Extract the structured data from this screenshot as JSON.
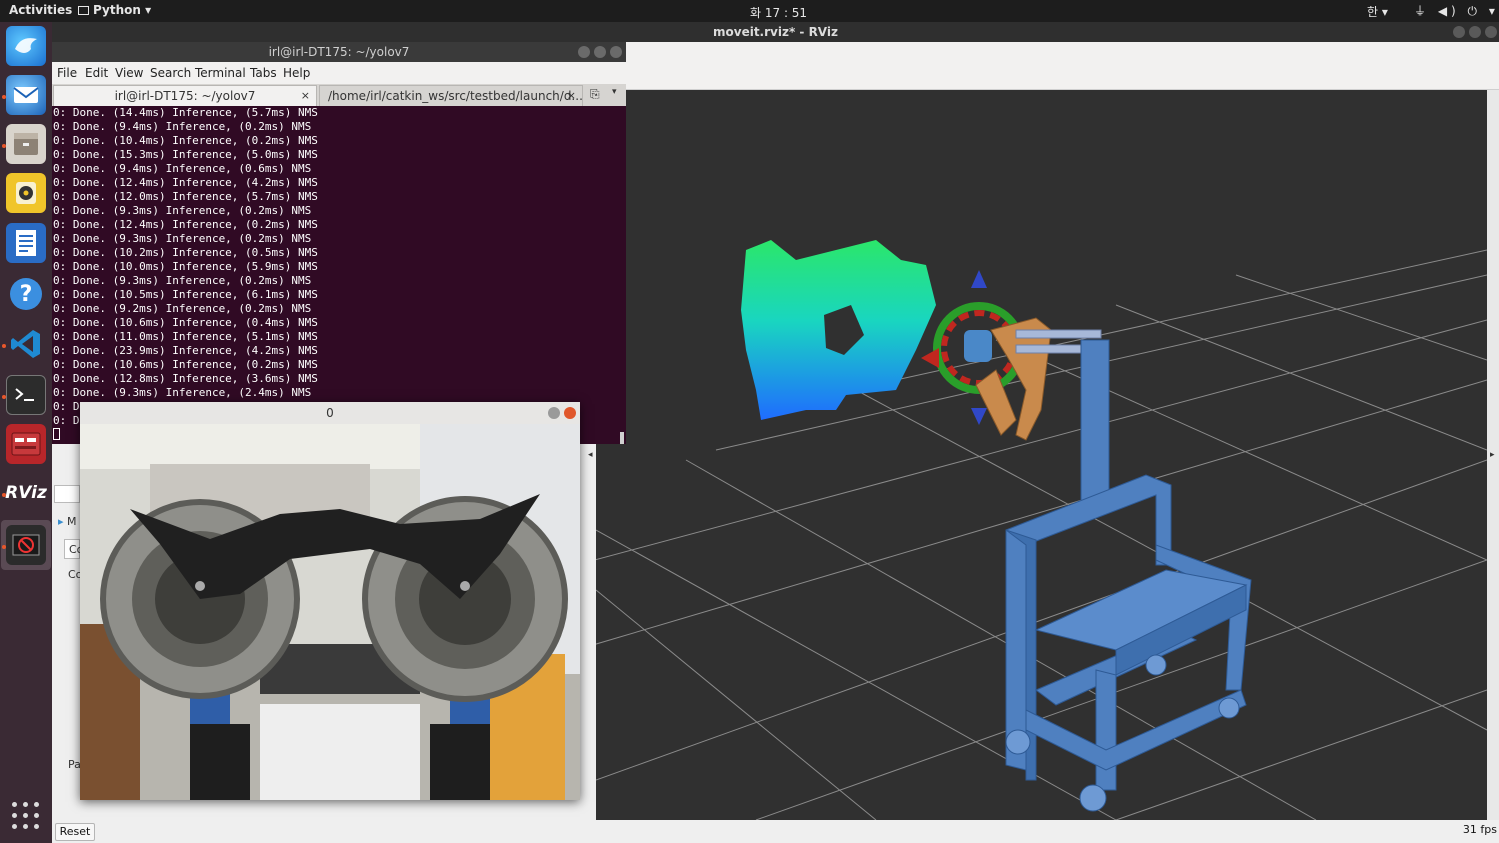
{
  "topbar": {
    "activities": "Activities",
    "app_menu": "Python ▾",
    "clock": "화 17 : 51",
    "ime": "한 ▾",
    "tray": "⏚ ◀) ⏻ ▾"
  },
  "rviz": {
    "title": "moveit.rviz* - RViz",
    "reset_label": "Reset",
    "fps": "31 fps",
    "left_fragments": [
      "M",
      "Co",
      "Co",
      "Pa"
    ]
  },
  "terminal": {
    "title": "irl@irl-DT175: ~/yolov7",
    "menu": [
      "File",
      "Edit",
      "View",
      "Search",
      "Terminal",
      "Tabs",
      "Help"
    ],
    "tabs": [
      {
        "label": "irl@irl-DT175: ~/yolov7",
        "close": "×"
      },
      {
        "label": "/home/irl/catkin_ws/src/testbed/launch/d...",
        "close": "×"
      }
    ],
    "lines": [
      "0: Done. (14.4ms) Inference, (5.7ms) NMS",
      "0: Done. (9.4ms) Inference, (0.2ms) NMS",
      "0: Done. (10.4ms) Inference, (0.2ms) NMS",
      "0: Done. (15.3ms) Inference, (5.0ms) NMS",
      "0: Done. (9.4ms) Inference, (0.6ms) NMS",
      "0: Done. (12.4ms) Inference, (4.2ms) NMS",
      "0: Done. (12.0ms) Inference, (5.7ms) NMS",
      "0: Done. (9.3ms) Inference, (0.2ms) NMS",
      "0: Done. (12.4ms) Inference, (0.2ms) NMS",
      "0: Done. (9.3ms) Inference, (0.2ms) NMS",
      "0: Done. (10.2ms) Inference, (0.5ms) NMS",
      "0: Done. (10.0ms) Inference, (5.9ms) NMS",
      "0: Done. (9.3ms) Inference, (0.2ms) NMS",
      "0: Done. (10.5ms) Inference, (6.1ms) NMS",
      "0: Done. (9.2ms) Inference, (0.2ms) NMS",
      "0: Done. (10.6ms) Inference, (0.4ms) NMS",
      "0: Done. (11.0ms) Inference, (5.1ms) NMS",
      "0: Done. (23.9ms) Inference, (4.2ms) NMS",
      "0: Done. (10.6ms) Inference, (0.2ms) NMS",
      "0: Done. (12.8ms) Inference, (3.6ms) NMS",
      "0: Done. (9.3ms) Inference, (2.4ms) NMS",
      "0: D",
      "0: D"
    ]
  },
  "camera_window": {
    "title": "0"
  },
  "dock": {
    "items": [
      "thunderbird-icon",
      "mail-icon",
      "files-icon",
      "rhythmbox-icon",
      "writer-icon",
      "help-icon",
      "vscode-icon",
      "terminal-icon",
      "system-monitor-icon",
      "rviz-icon",
      "blocked-app-icon"
    ],
    "rviz_label": "RViz"
  }
}
